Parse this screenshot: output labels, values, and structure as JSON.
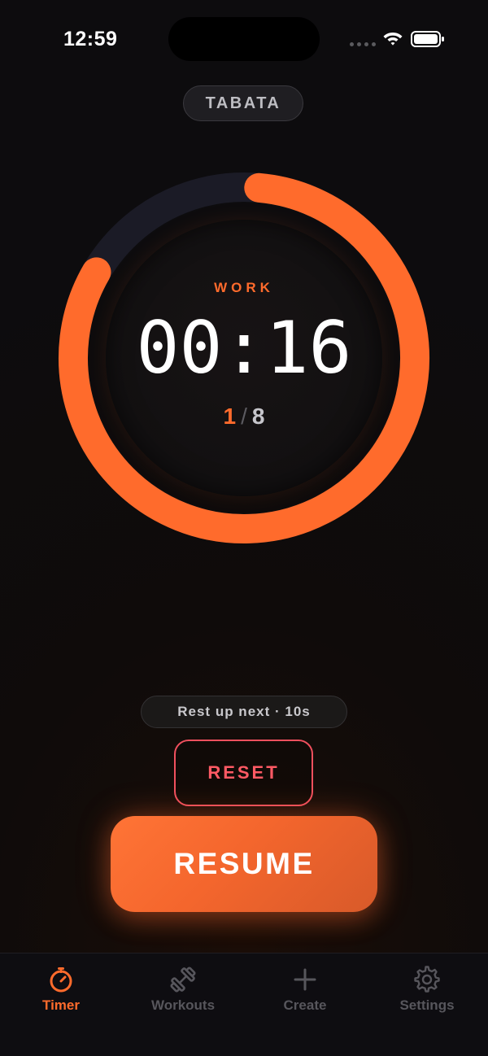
{
  "status_bar": {
    "time": "12:59"
  },
  "mode": {
    "label": "TABATA"
  },
  "timer": {
    "phase": "WORK",
    "countdown": "00:16",
    "round_current": "1",
    "round_separator": "/",
    "round_total": "8",
    "progress_fraction": 0.82,
    "ring_color": "#ff6b2c",
    "track_color": "#1b1b26"
  },
  "next_up": {
    "label": "Rest up next · 10s"
  },
  "controls": {
    "reset_label": "RESET",
    "resume_label": "RESUME"
  },
  "tab_bar": {
    "items": [
      {
        "label": "Timer",
        "icon": "stopwatch-icon",
        "active": true
      },
      {
        "label": "Workouts",
        "icon": "dumbbell-icon",
        "active": false
      },
      {
        "label": "Create",
        "icon": "plus-icon",
        "active": false
      },
      {
        "label": "Settings",
        "icon": "gear-icon",
        "active": false
      }
    ]
  },
  "colors": {
    "accent": "#ff6b2c",
    "danger": "#ff5a64",
    "inactive": "#57565c"
  }
}
